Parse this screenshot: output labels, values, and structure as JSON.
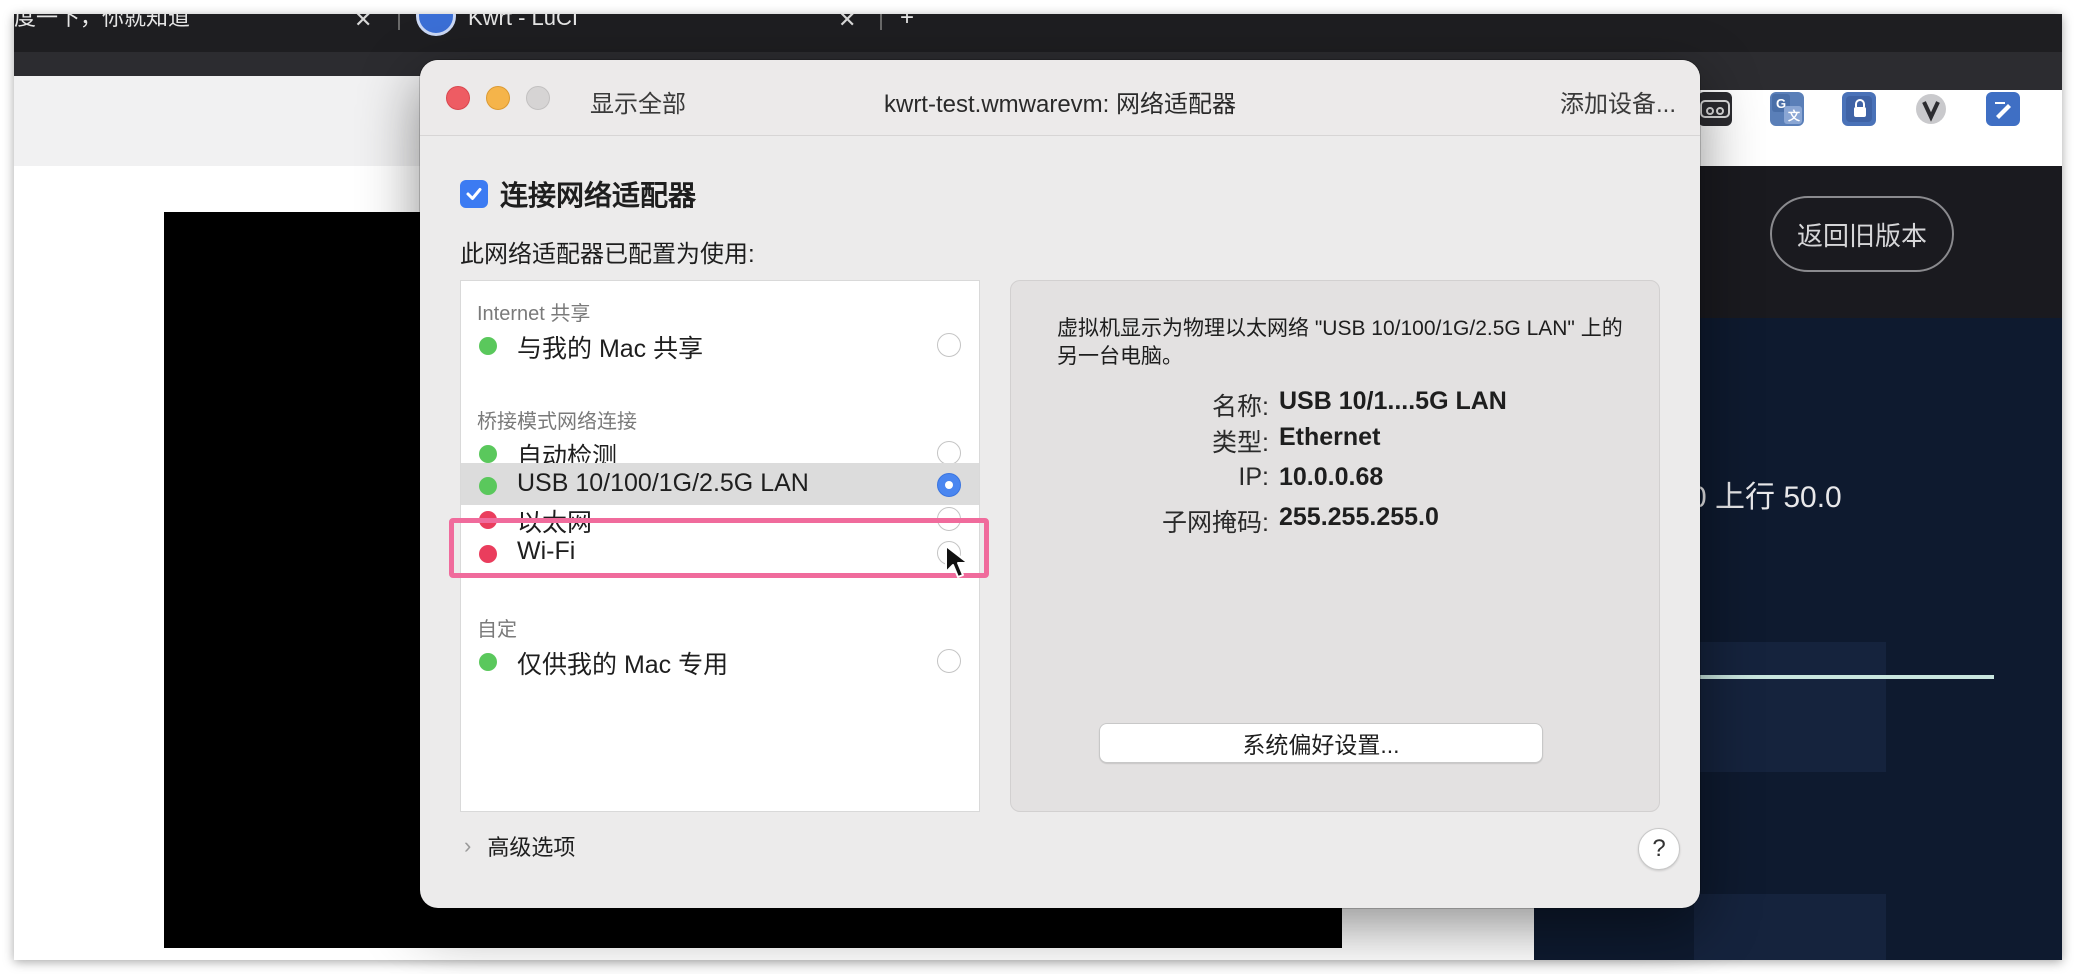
{
  "browser": {
    "tab1_title": "度一下，你就知道",
    "tab2_title": "Kwrt - LuCI",
    "tab_close_glyph": "✕",
    "new_tab_glyph": "+",
    "extensions": [
      "bookmark-icon",
      "translate-icon",
      "lock-icon",
      "v-icon",
      "edit-icon"
    ]
  },
  "page": {
    "back_old_version": "返回旧版本",
    "speed_text": "0 上行 50.0"
  },
  "dialog": {
    "show_all": "显示全部",
    "title": "kwrt-test.wmwarevm: 网络适配器",
    "add_device": "添加设备...",
    "connect_label": "连接网络适配器",
    "connect_checked": true,
    "configured_label": "此网络适配器已配置为使用:",
    "sections": [
      {
        "header": "Internet 共享",
        "items": [
          {
            "label": "与我的 Mac 共享",
            "status": "green",
            "selected": false
          }
        ]
      },
      {
        "header": "桥接模式网络连接",
        "items": [
          {
            "label": "自动检测",
            "status": "green",
            "selected": false
          },
          {
            "label": "USB 10/100/1G/2.5G LAN",
            "status": "green",
            "selected": true
          },
          {
            "label": "以太网",
            "status": "red",
            "selected": false
          },
          {
            "label": "Wi-Fi",
            "status": "red",
            "selected": false
          }
        ]
      },
      {
        "header": "自定",
        "items": [
          {
            "label": "仅供我的 Mac 专用",
            "status": "green",
            "selected": false
          }
        ]
      }
    ],
    "info": {
      "description": "虚拟机显示为物理以太网络 \"USB 10/100/1G/2.5G LAN\" 上的另一台电脑。",
      "name_key": "名称:",
      "name_val": "USB 10/1....5G LAN",
      "type_key": "类型:",
      "type_val": "Ethernet",
      "ip_key": "IP:",
      "ip_val": "10.0.0.68",
      "mask_key": "子网掩码:",
      "mask_val": "255.255.255.0",
      "sys_pref_button": "系统偏好设置..."
    },
    "advanced_label": "高级选项",
    "help_label": "?"
  },
  "colors": {
    "accent_blue": "#3c7bf2",
    "status_green": "#5ac85c",
    "status_red": "#ea3d5d",
    "highlight_pink": "#f06b9c"
  }
}
